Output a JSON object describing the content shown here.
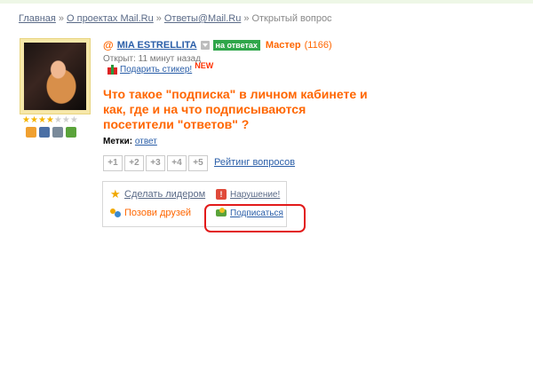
{
  "breadcrumb": {
    "items": [
      "Главная",
      "О проектах Mail.Ru",
      "Ответы@Mail.Ru"
    ],
    "current": "Открытый вопрос",
    "separator": "»"
  },
  "user": {
    "at_symbol": "@",
    "name": "MIA ESTRELLITA",
    "online_badge": "на ответах",
    "rank": "Мастер",
    "points": "(1166)",
    "stars": {
      "filled": 4,
      "total": 7
    },
    "award_icons": [
      "people-award-icon",
      "camera-award-icon",
      "gallery-award-icon",
      "pencil-award-icon"
    ]
  },
  "question": {
    "opened": "Открыт: 11 минут назад",
    "gift_label": "Подарить стикер!",
    "new_label": "NEW",
    "title": "Что такое \"подписка\" в личном кабинете и как, где и на что подписываются посетители \"ответов\" ?"
  },
  "tags": {
    "label": "Метки:",
    "value": "ответ"
  },
  "votes": [
    "+1",
    "+2",
    "+3",
    "+4",
    "+5"
  ],
  "rating_link": "Рейтинг вопросов",
  "actions": {
    "make_leader": "Сделать лидером",
    "violation": "Нарушение!",
    "invite_friends": "Позови друзей",
    "subscribe": "Подписаться"
  },
  "colors": {
    "accent": "#ff6600",
    "link": "#2a5ea8",
    "online": "#2fa64a",
    "highlight": "#e21a1a"
  }
}
